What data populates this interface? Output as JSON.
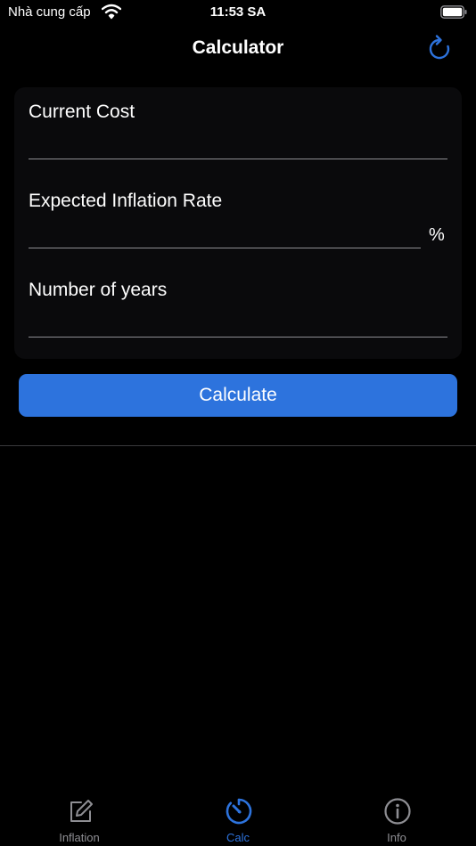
{
  "status_bar": {
    "carrier": "Nhà cung cấp",
    "time": "11:53 SA"
  },
  "nav": {
    "title": "Calculator",
    "refresh_icon": "refresh-icon"
  },
  "form": {
    "fields": [
      {
        "label": "Current Cost",
        "value": ""
      },
      {
        "label": "Expected Inflation Rate",
        "value": "",
        "suffix": "%"
      },
      {
        "label": "Number of years",
        "value": ""
      }
    ]
  },
  "calculate_button": {
    "label": "Calculate"
  },
  "tabs": [
    {
      "label": "Inflation",
      "icon": "edit-icon",
      "selected": false
    },
    {
      "label": "Calc",
      "icon": "timer-icon",
      "selected": true
    },
    {
      "label": "Info",
      "icon": "info-icon",
      "selected": false
    }
  ],
  "colors": {
    "accent": "#2d73dd",
    "tab_inactive": "#8e8e93",
    "background": "#000000"
  }
}
